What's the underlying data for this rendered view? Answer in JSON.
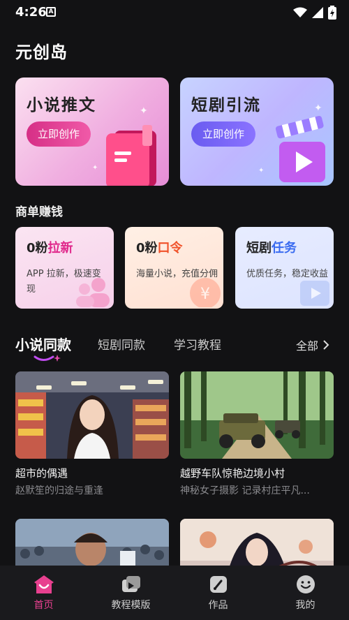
{
  "status_bar": {
    "time": "4:26",
    "notification_icon": "A"
  },
  "app": {
    "title": "元创岛"
  },
  "features": [
    {
      "title": "小说推文",
      "button": "立即创作",
      "icon": "book-icon"
    },
    {
      "title": "短剧引流",
      "button": "立即创作",
      "icon": "clapperboard-icon"
    }
  ],
  "earn_section": {
    "title": "商单赚钱"
  },
  "tasks": [
    {
      "prefix": "0粉",
      "highlight": "拉新",
      "desc": "APP 拉新，极速变现",
      "highlight_color": "#e0288b"
    },
    {
      "prefix": "0粉",
      "highlight": "口令",
      "desc": "海量小说，充值分佣",
      "highlight_color": "#f0522a"
    },
    {
      "prefix": "短剧",
      "highlight": "任务",
      "desc": "优质任务，稳定收益",
      "highlight_color": "#3b6cf0"
    }
  ],
  "tabs": {
    "items": [
      "小说同款",
      "短剧同款",
      "学习教程"
    ],
    "active": "小说同款",
    "all_label": "全部"
  },
  "content": [
    {
      "title": "超市的偶遇",
      "subtitle": "赵默笙的归途与重逢"
    },
    {
      "title": "越野车队惊艳边境小村",
      "subtitle": "神秘女子摄影 记录村庄平凡..."
    },
    {
      "title": "",
      "subtitle": ""
    },
    {
      "title": "",
      "subtitle": ""
    }
  ],
  "bottom_nav": [
    {
      "label": "首页",
      "icon": "home-icon",
      "active": true
    },
    {
      "label": "教程模版",
      "icon": "video-template-icon",
      "active": false
    },
    {
      "label": "作品",
      "icon": "works-icon",
      "active": false
    },
    {
      "label": "我的",
      "icon": "profile-icon",
      "active": false
    }
  ]
}
